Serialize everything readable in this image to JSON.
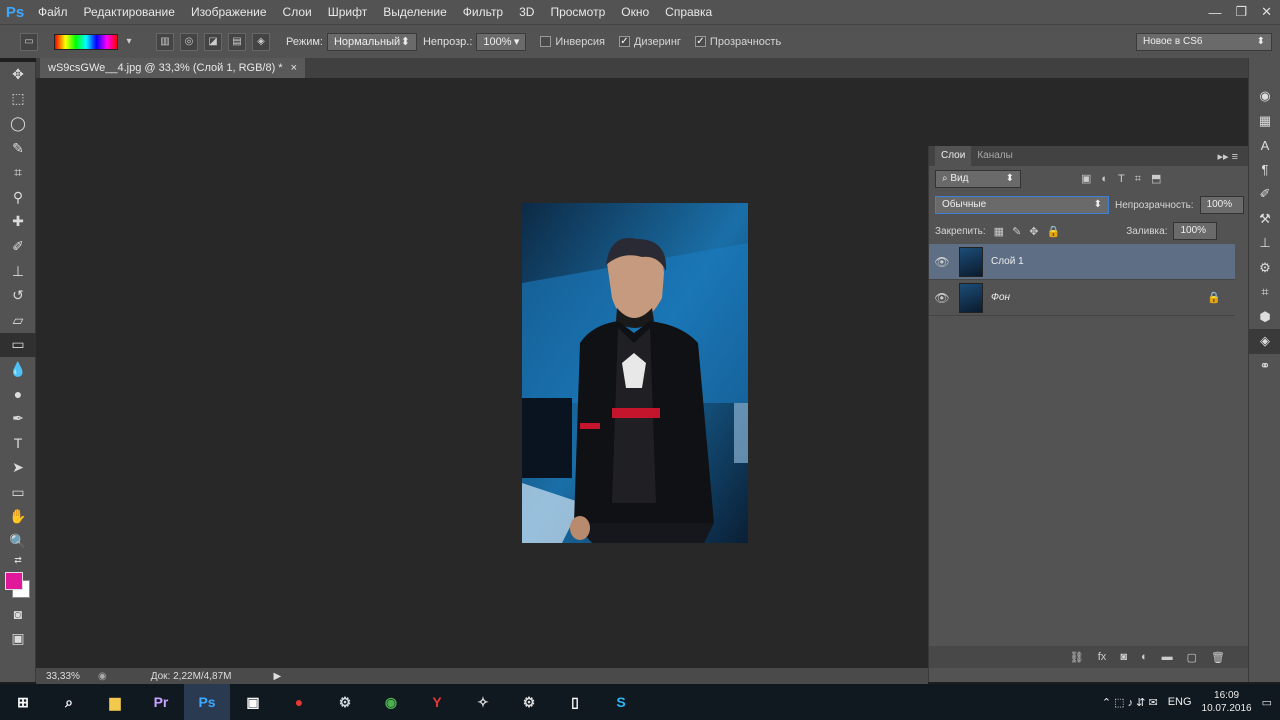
{
  "app": {
    "logo": "Ps",
    "window_controls": [
      "—",
      "❐",
      "✕"
    ]
  },
  "menu": [
    "Файл",
    "Редактирование",
    "Изображение",
    "Слои",
    "Шрифт",
    "Выделение",
    "Фильтр",
    "3D",
    "Просмотр",
    "Окно",
    "Справка"
  ],
  "options": {
    "mode_label": "Режим:",
    "mode_value": "Нормальный",
    "opacity_label": "Непрозр.:",
    "opacity_value": "100%",
    "inverse_label": "Инверсия",
    "dither_label": "Дизеринг",
    "transparency_label": "Прозрачность",
    "inverse_checked": false,
    "dither_checked": true,
    "transparency_checked": true,
    "workspace": "Новое в CS6"
  },
  "document": {
    "tab_title": "wS9csGWe__4.jpg @ 33,3% (Слой 1, RGB/8) *",
    "close": "×"
  },
  "status": {
    "zoom": "33,33%",
    "doc": "Док: 2,22M/4,87M"
  },
  "colors": {
    "foreground": "#e0199a",
    "background": "#ffffff",
    "selected_layer": "#5d6e85"
  },
  "layers_panel": {
    "tabs": [
      "Слои",
      "Каналы"
    ],
    "filter": "Вид",
    "blend_mode": "Обычные",
    "opacity_label": "Непрозрачность:",
    "opacity_value": "100%",
    "lock_label": "Закрепить:",
    "fill_label": "Заливка:",
    "fill_value": "100%",
    "layers": [
      {
        "name": "Слой 1",
        "selected": true,
        "locked": false
      },
      {
        "name": "Фон",
        "selected": false,
        "locked": true
      }
    ]
  },
  "taskbar": {
    "lang": "ENG",
    "time": "16:09",
    "date": "10.07.2016"
  }
}
